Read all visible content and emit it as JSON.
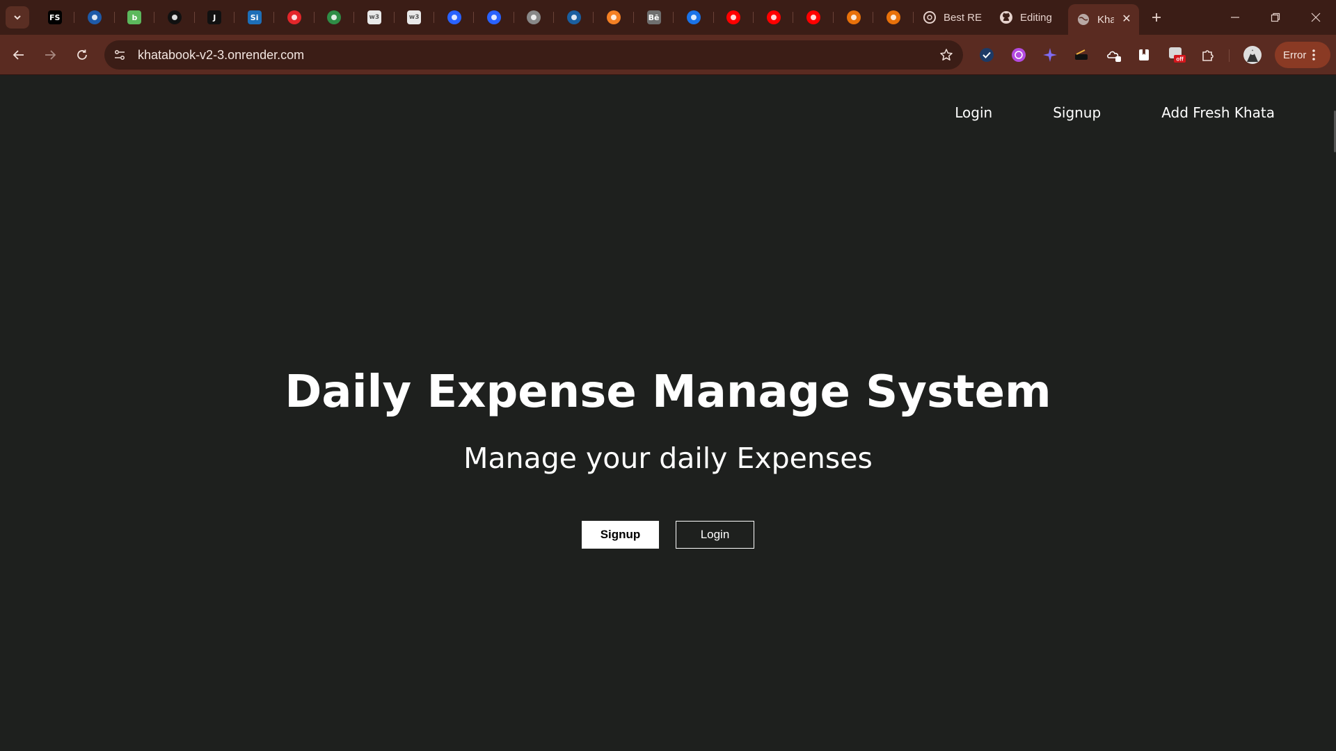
{
  "browser": {
    "pinned_tabs": [
      {
        "icon": "fs-favicon-icon",
        "text": "FS",
        "color": "#000000"
      },
      {
        "icon": "headset-favicon-icon",
        "text": "",
        "color": "#1e5aa8"
      },
      {
        "icon": "green-circle-favicon-icon",
        "text": "b",
        "color": "#5cb85c"
      },
      {
        "icon": "clock-favicon-icon",
        "text": "",
        "color": "#111111"
      },
      {
        "icon": "j-favicon-icon",
        "text": "J",
        "color": "#111111"
      },
      {
        "icon": "si-favicon-icon",
        "text": "Si",
        "color": "#1d6fb8"
      },
      {
        "icon": "red-ring-favicon-icon",
        "text": "",
        "color": "#e3262a"
      },
      {
        "icon": "gfg-favicon-icon",
        "text": "",
        "color": "#2f8d46"
      },
      {
        "icon": "w3-favicon-icon",
        "text": "w3",
        "color": "#e8e8e8"
      },
      {
        "icon": "w3-favicon-icon",
        "text": "w3",
        "color": "#e8e8e8"
      },
      {
        "icon": "blue-k-favicon-icon",
        "text": "",
        "color": "#2962ff"
      },
      {
        "icon": "blue-k-favicon-icon",
        "text": "",
        "color": "#2962ff"
      },
      {
        "icon": "brain-favicon-icon",
        "text": "",
        "color": "#888888"
      },
      {
        "icon": "globe-favicon-icon",
        "text": "",
        "color": "#1a5fa0"
      },
      {
        "icon": "stack-favicon-icon",
        "text": "",
        "color": "#f48024"
      },
      {
        "icon": "behance-favicon-icon",
        "text": "Bē",
        "color": "#6f6f6f"
      },
      {
        "icon": "play-favicon-icon",
        "text": "",
        "color": "#1a73e8"
      },
      {
        "icon": "youtube-favicon-icon",
        "text": "",
        "color": "#ff0000"
      },
      {
        "icon": "youtube-favicon-icon",
        "text": "",
        "color": "#ff0000"
      },
      {
        "icon": "youtube-favicon-icon",
        "text": "",
        "color": "#ff0000"
      },
      {
        "icon": "figure-favicon-icon",
        "text": "",
        "color": "#e8710a"
      },
      {
        "icon": "figure-favicon-icon",
        "text": "",
        "color": "#e8710a"
      }
    ],
    "tabs": [
      {
        "label": "Best RE",
        "icon": "openai-icon"
      },
      {
        "label": "Editing",
        "icon": "github-icon"
      }
    ],
    "active_tab": {
      "label": "Khatabook",
      "icon": "globe-icon"
    },
    "url": "khatabook-v2-3.onrender.com",
    "error_label": "Error",
    "accent": "#5a2b21"
  },
  "page": {
    "nav": {
      "login": "Login",
      "signup": "Signup",
      "add_khata": "Add Fresh Khata"
    },
    "hero": {
      "title": "Daily Expense Manage System",
      "subtitle": "Manage your daily Expenses"
    },
    "buttons": {
      "signup": "Signup",
      "login": "Login"
    },
    "background": "#1e201e"
  }
}
